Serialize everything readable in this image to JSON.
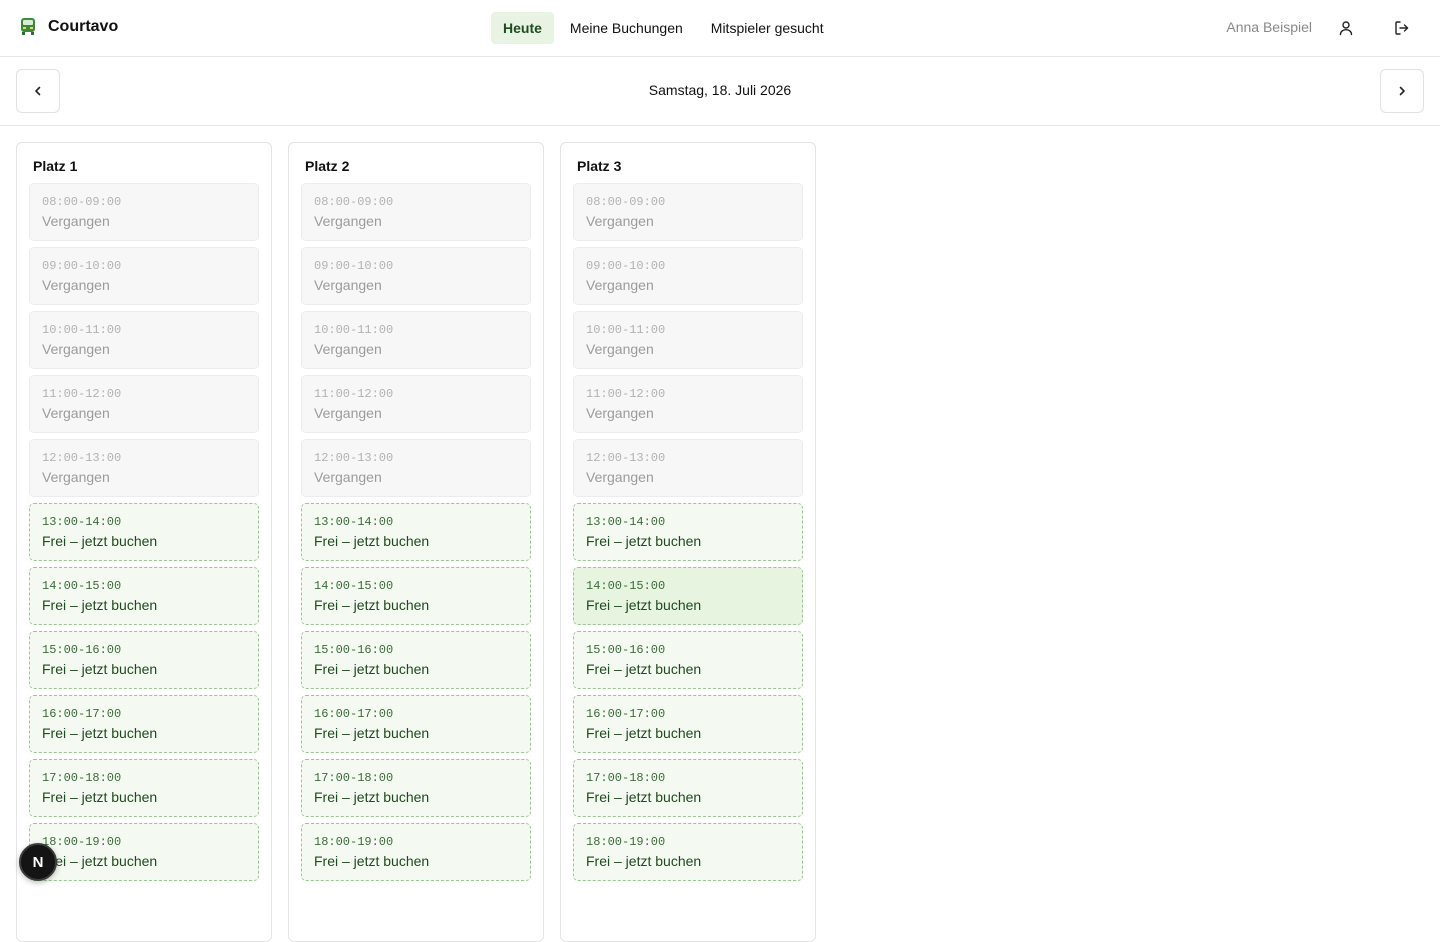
{
  "app": {
    "name": "Courtavo",
    "brand_color": "#3a8a3a"
  },
  "nav": {
    "items": [
      {
        "label": "Heute",
        "active": true
      },
      {
        "label": "Meine Buchungen",
        "active": false
      },
      {
        "label": "Mitspieler gesucht",
        "active": false
      }
    ]
  },
  "user": {
    "name": "Anna Beispiel",
    "profile_icon": "user-icon",
    "logout_icon": "logout-icon"
  },
  "date_nav": {
    "date": "Samstag, 18. Juli 2026",
    "prev_icon": "chevron-left-icon",
    "next_icon": "chevron-right-icon"
  },
  "courts": [
    {
      "name": "Platz 1",
      "slots": [
        {
          "time": "08:00-09:00",
          "status": "Vergangen",
          "state": "past"
        },
        {
          "time": "09:00-10:00",
          "status": "Vergangen",
          "state": "past"
        },
        {
          "time": "10:00-11:00",
          "status": "Vergangen",
          "state": "past"
        },
        {
          "time": "11:00-12:00",
          "status": "Vergangen",
          "state": "past"
        },
        {
          "time": "12:00-13:00",
          "status": "Vergangen",
          "state": "past"
        },
        {
          "time": "13:00-14:00",
          "status": "Frei – jetzt buchen",
          "state": "free"
        },
        {
          "time": "14:00-15:00",
          "status": "Frei – jetzt buchen",
          "state": "free"
        },
        {
          "time": "15:00-16:00",
          "status": "Frei – jetzt buchen",
          "state": "free"
        },
        {
          "time": "16:00-17:00",
          "status": "Frei – jetzt buchen",
          "state": "free"
        },
        {
          "time": "17:00-18:00",
          "status": "Frei – jetzt buchen",
          "state": "free"
        },
        {
          "time": "18:00-19:00",
          "status": "Frei – jetzt buchen",
          "state": "free"
        }
      ]
    },
    {
      "name": "Platz 2",
      "slots": [
        {
          "time": "08:00-09:00",
          "status": "Vergangen",
          "state": "past"
        },
        {
          "time": "09:00-10:00",
          "status": "Vergangen",
          "state": "past"
        },
        {
          "time": "10:00-11:00",
          "status": "Vergangen",
          "state": "past"
        },
        {
          "time": "11:00-12:00",
          "status": "Vergangen",
          "state": "past"
        },
        {
          "time": "12:00-13:00",
          "status": "Vergangen",
          "state": "past"
        },
        {
          "time": "13:00-14:00",
          "status": "Frei – jetzt buchen",
          "state": "free"
        },
        {
          "time": "14:00-15:00",
          "status": "Frei – jetzt buchen",
          "state": "free"
        },
        {
          "time": "15:00-16:00",
          "status": "Frei – jetzt buchen",
          "state": "free"
        },
        {
          "time": "16:00-17:00",
          "status": "Frei – jetzt buchen",
          "state": "free"
        },
        {
          "time": "17:00-18:00",
          "status": "Frei – jetzt buchen",
          "state": "free"
        },
        {
          "time": "18:00-19:00",
          "status": "Frei – jetzt buchen",
          "state": "free"
        }
      ]
    },
    {
      "name": "Platz 3",
      "slots": [
        {
          "time": "08:00-09:00",
          "status": "Vergangen",
          "state": "past"
        },
        {
          "time": "09:00-10:00",
          "status": "Vergangen",
          "state": "past"
        },
        {
          "time": "10:00-11:00",
          "status": "Vergangen",
          "state": "past"
        },
        {
          "time": "11:00-12:00",
          "status": "Vergangen",
          "state": "past"
        },
        {
          "time": "12:00-13:00",
          "status": "Vergangen",
          "state": "past"
        },
        {
          "time": "13:00-14:00",
          "status": "Frei – jetzt buchen",
          "state": "free"
        },
        {
          "time": "14:00-15:00",
          "status": "Frei – jetzt buchen",
          "state": "free-hover"
        },
        {
          "time": "15:00-16:00",
          "status": "Frei – jetzt buchen",
          "state": "free"
        },
        {
          "time": "16:00-17:00",
          "status": "Frei – jetzt buchen",
          "state": "free"
        },
        {
          "time": "17:00-18:00",
          "status": "Frei – jetzt buchen",
          "state": "free"
        },
        {
          "time": "18:00-19:00",
          "status": "Frei – jetzt buchen",
          "state": "free"
        }
      ]
    }
  ],
  "dev_badge": {
    "label": "N"
  }
}
